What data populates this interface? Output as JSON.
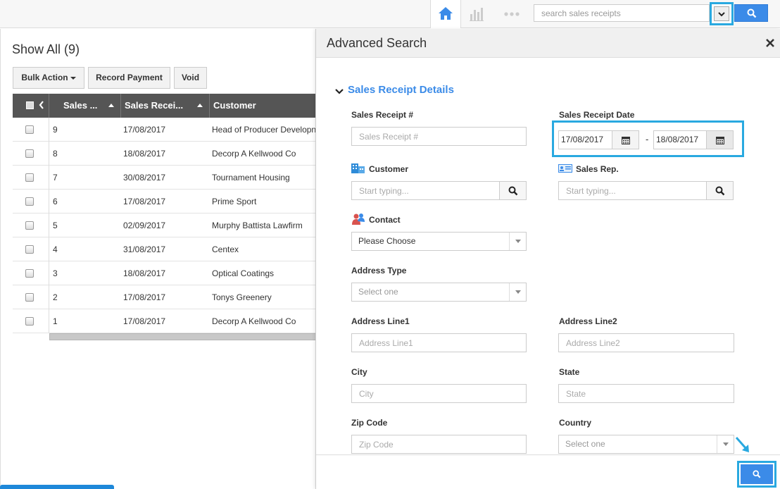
{
  "topbar": {
    "icons": [
      "home-icon",
      "bar-chart-icon",
      "more-dots-icon"
    ],
    "search_placeholder": "search sales receipts",
    "accent": "#3b8be8",
    "highlight": "#29a9e0"
  },
  "list": {
    "title": "Show All (9)",
    "bulk_action": "Bulk Action",
    "record_payment": "Record Payment",
    "void": "Void",
    "columns": [
      "Sales ...",
      "Sales Recei...",
      "Customer"
    ],
    "rows": [
      {
        "num": "9",
        "date": "17/08/2017",
        "customer": "Head of Producer Developn"
      },
      {
        "num": "8",
        "date": "18/08/2017",
        "customer": "Decorp A Kellwood Co"
      },
      {
        "num": "7",
        "date": "30/08/2017",
        "customer": "Tournament Housing"
      },
      {
        "num": "6",
        "date": "17/08/2017",
        "customer": "Prime Sport"
      },
      {
        "num": "5",
        "date": "02/09/2017",
        "customer": "Murphy Battista Lawfirm"
      },
      {
        "num": "4",
        "date": "31/08/2017",
        "customer": "Centex"
      },
      {
        "num": "3",
        "date": "18/08/2017",
        "customer": "Optical Coatings"
      },
      {
        "num": "2",
        "date": "17/08/2017",
        "customer": "Tonys Greenery"
      },
      {
        "num": "1",
        "date": "17/08/2017",
        "customer": "Decorp A Kellwood Co"
      }
    ]
  },
  "advanced": {
    "title": "Advanced Search",
    "section": "Sales Receipt Details",
    "sales_receipt_label": "Sales Receipt #",
    "sales_receipt_placeholder": "Sales Receipt #",
    "date_label": "Sales Receipt Date",
    "date_from": "17/08/2017",
    "date_to": "18/08/2017",
    "date_sep": "-",
    "customer_label": "Customer",
    "customer_placeholder": "Start typing...",
    "salesrep_label": "Sales Rep.",
    "salesrep_placeholder": "Start typing...",
    "contact_label": "Contact",
    "contact_value": "Please Choose",
    "address_type_label": "Address Type",
    "address_type_value": "Select one",
    "address1_label": "Address Line1",
    "address1_placeholder": "Address Line1",
    "address2_label": "Address Line2",
    "address2_placeholder": "Address Line2",
    "city_label": "City",
    "city_placeholder": "City",
    "state_label": "State",
    "state_placeholder": "State",
    "zip_label": "Zip Code",
    "zip_placeholder": "Zip Code",
    "country_label": "Country",
    "country_value": "Select one"
  }
}
